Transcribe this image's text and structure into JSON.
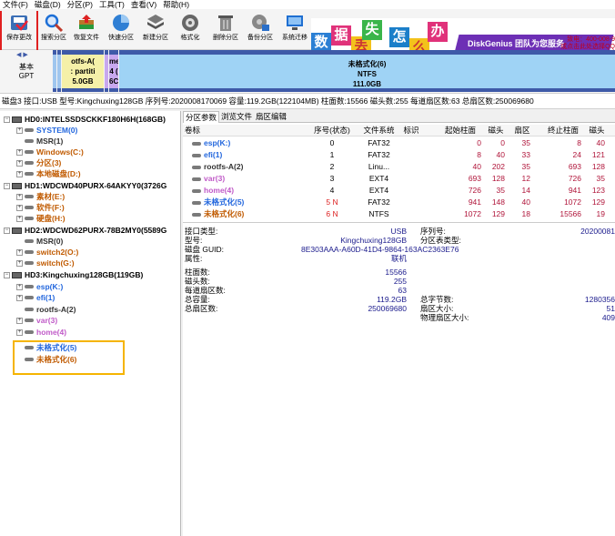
{
  "menu": [
    "文件(F)",
    "磁盘(D)",
    "分区(P)",
    "工具(T)",
    "查看(V)",
    "帮助(H)"
  ],
  "toolbar": {
    "buttons": [
      {
        "label": "保存更改",
        "icon": "save-icon"
      },
      {
        "label": "搜索分区",
        "icon": "search-icon"
      },
      {
        "label": "恢复文件",
        "icon": "recover-icon"
      },
      {
        "label": "快速分区",
        "icon": "quick-partition-icon"
      },
      {
        "label": "新建分区",
        "icon": "new-partition-icon"
      },
      {
        "label": "格式化",
        "icon": "format-icon"
      },
      {
        "label": "删除分区",
        "icon": "trash-icon"
      },
      {
        "label": "备份分区",
        "icon": "backup-icon"
      },
      {
        "label": "系统迁移",
        "icon": "migrate-icon"
      }
    ]
  },
  "banner": {
    "tiles": [
      "数",
      "据",
      "丢",
      "失",
      "怎",
      "么",
      "办"
    ],
    "brand": "DiskGenius 团队为您服务",
    "hotline_line1": "致电：400-008-9",
    "hotline_line2": "或点击此处选择QQ"
  },
  "diskmap": {
    "disk_label_line1": "基本",
    "disk_label_line2": "GPT",
    "small_seg": {
      "name": "otfs-A(",
      "fs": ": partiti",
      "size": "5.0GB"
    },
    "home_seg": {
      "name": "me",
      "fs": "4 (",
      "size": "6C"
    },
    "big_seg": {
      "name": "未格式化(6)",
      "fs": "NTFS",
      "size": "111.0GB"
    }
  },
  "infoline": "磁盘3 接口:USB  型号:Kingchuxing128GB  序列号:2020008170069  容量:119.2GB(122104MB)  柱面数:15566  磁头数:255  每道扇区数:63  总扇区数:250069680",
  "tree": {
    "disks": [
      {
        "name": "HD0:INTELSSDSCKKF180H6H(168GB)",
        "parts": [
          {
            "name": "SYSTEM(0)",
            "color": "#2266dd",
            "exp": true
          },
          {
            "name": "MSR(1)",
            "color": "#333333",
            "exp": false
          },
          {
            "name": "Windows(C:)",
            "color": "#c05a00",
            "exp": true
          },
          {
            "name": "分区(3)",
            "color": "#c05a00",
            "exp": true
          },
          {
            "name": "本地磁盘(D:)",
            "color": "#c05a00",
            "exp": true
          }
        ]
      },
      {
        "name": "HD1:WDCWD40PURX-64AKYY0(3726G",
        "parts": [
          {
            "name": "素材(E:)",
            "color": "#c05a00",
            "exp": true
          },
          {
            "name": "软件(F:)",
            "color": "#c05a00",
            "exp": true
          },
          {
            "name": "硬盘(H:)",
            "color": "#c05a00",
            "exp": true
          }
        ]
      },
      {
        "name": "HD2:WDCWD62PURX-78B2MY0(5589G",
        "parts": [
          {
            "name": "MSR(0)",
            "color": "#333333",
            "exp": false
          },
          {
            "name": "switch2(O:)",
            "color": "#c05a00",
            "exp": true
          },
          {
            "name": "switch(G:)",
            "color": "#c05a00",
            "exp": true
          }
        ]
      },
      {
        "name": "HD3:Kingchuxing128GB(119GB)",
        "parts": [
          {
            "name": "esp(K:)",
            "color": "#2266dd",
            "exp": true
          },
          {
            "name": "efi(1)",
            "color": "#2266dd",
            "exp": true
          },
          {
            "name": "rootfs-A(2)",
            "color": "#333333",
            "exp": false
          },
          {
            "name": "var(3)",
            "color": "#c05ac8",
            "exp": true
          },
          {
            "name": "home(4)",
            "color": "#c05ac8",
            "exp": true
          },
          {
            "name": "未格式化(5)",
            "color": "#2266dd",
            "exp": false
          },
          {
            "name": "未格式化(6)",
            "color": "#c05a00",
            "exp": false
          }
        ]
      }
    ]
  },
  "tabs": [
    "分区参数",
    "浏览文件",
    "扇区编辑"
  ],
  "ptable": {
    "headers": [
      "卷标",
      "序号(状态)",
      "文件系统",
      "标识",
      "起始柱面",
      "磁头",
      "扇区",
      "终止柱面",
      "磁头"
    ],
    "rows": [
      {
        "name": "esp(K:)",
        "color": "#2266dd",
        "seq": "0",
        "fs": "FAT32",
        "sc": "0",
        "sh": "0",
        "ss": "35",
        "ec": "8",
        "eh": "40"
      },
      {
        "name": "efi(1)",
        "color": "#2266dd",
        "seq": "1",
        "fs": "FAT32",
        "sc": "8",
        "sh": "40",
        "ss": "33",
        "ec": "24",
        "eh": "121"
      },
      {
        "name": "rootfs-A(2)",
        "color": "#333333",
        "seq": "2",
        "fs": "Linu...",
        "sc": "40",
        "sh": "202",
        "ss": "35",
        "ec": "693",
        "eh": "128"
      },
      {
        "name": "var(3)",
        "color": "#c05ac8",
        "seq": "3",
        "fs": "EXT4",
        "sc": "693",
        "sh": "128",
        "ss": "12",
        "ec": "726",
        "eh": "35"
      },
      {
        "name": "home(4)",
        "color": "#c05ac8",
        "seq": "4",
        "fs": "EXT4",
        "sc": "726",
        "sh": "35",
        "ss": "14",
        "ec": "941",
        "eh": "123"
      },
      {
        "name": "未格式化(5)",
        "color": "#2266dd",
        "seq": "5 N",
        "fs": "FAT32",
        "sc": "941",
        "sh": "148",
        "ss": "40",
        "ec": "1072",
        "eh": "129"
      },
      {
        "name": "未格式化(6)",
        "color": "#c05a00",
        "seq": "6 N",
        "fs": "NTFS",
        "sc": "1072",
        "sh": "129",
        "ss": "18",
        "ec": "15566",
        "eh": "19"
      }
    ]
  },
  "props": {
    "iface_label": "接口类型:",
    "iface": "USB",
    "serial_label": "序列号:",
    "serial": "20200081",
    "model_label": "型号:",
    "model": "Kingchuxing128GB",
    "ptype_label": "分区表类型:",
    "guid_label": "磁盘 GUID:",
    "guid": "8E303AAA-A60D-41D4-9864-163AC2363E76",
    "attr_label": "属性:",
    "attr": "联机",
    "cyl_label": "柱面数:",
    "cyl": "15566",
    "heads_label": "磁头数:",
    "heads": "255",
    "spt_label": "每道扇区数:",
    "spt": "63",
    "cap_label": "总容量:",
    "cap": "119.2GB",
    "totalbytes_label": "总字节数:",
    "totalbytes": "1280356",
    "totalsec_label": "总扇区数:",
    "totalsec": "250069680",
    "secsize_label": "扇区大小:",
    "secsize": "51",
    "physsec_label": "物理扇区大小:",
    "physsec": "409"
  }
}
